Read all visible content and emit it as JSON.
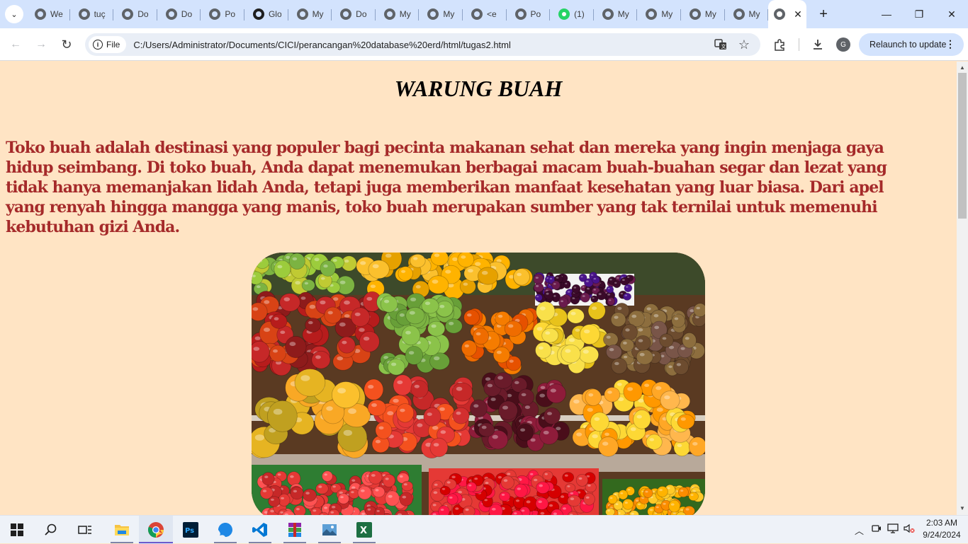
{
  "browser": {
    "tabs": [
      {
        "label": "We",
        "favicon": "globe-icon"
      },
      {
        "label": "tuç",
        "favicon": "globe-icon"
      },
      {
        "label": "Do",
        "favicon": "globe-icon"
      },
      {
        "label": "Do",
        "favicon": "globe-icon"
      },
      {
        "label": "Po",
        "favicon": "globe-icon"
      },
      {
        "label": "Glo",
        "favicon": "github-icon"
      },
      {
        "label": "My",
        "favicon": "globe-icon"
      },
      {
        "label": "Do",
        "favicon": "globe-icon"
      },
      {
        "label": "My",
        "favicon": "globe-icon"
      },
      {
        "label": "My",
        "favicon": "globe-icon"
      },
      {
        "label": "<e",
        "favicon": "globe-icon"
      },
      {
        "label": "Po",
        "favicon": "globe-icon"
      },
      {
        "label": "(1)",
        "favicon": "whatsapp-icon"
      },
      {
        "label": "My",
        "favicon": "globe-icon"
      },
      {
        "label": "My",
        "favicon": "globe-icon"
      },
      {
        "label": "My",
        "favicon": "globe-icon"
      },
      {
        "label": "My",
        "favicon": "globe-icon"
      }
    ],
    "active_tab_close": "✕",
    "new_tab": "+",
    "window": {
      "minimize": "—",
      "restore": "❐",
      "close": "✕"
    },
    "nav": {
      "back": "←",
      "forward": "→",
      "reload": "↻"
    },
    "address": {
      "chip_label": "File",
      "chip_icon": "i",
      "url": "C:/Users/Administrator/Documents/CICI/perancangan%20database%20erd/html/tugas2.html"
    },
    "avatar_letter": "G",
    "relaunch_label": "Relaunch to update",
    "menu_dots": "⋮"
  },
  "page": {
    "title": "WARUNG BUAH",
    "intro": "Toko buah adalah destinasi yang populer bagi pecinta makanan sehat dan mereka yang ingin menjaga gaya hidup seimbang. Di toko buah, Anda dapat menemukan berbagai macam buah-buahan segar dan lezat yang tidak hanya memanjakan lidah Anda, tetapi juga memberikan manfaat kesehatan yang luar biasa. Dari apel yang renyah hingga mangga yang manis, toko buah merupakan sumber yang tak ternilai untuk memenuhi kebutuhan gizi Anda.",
    "background_color": "#ffe4c4",
    "intro_color": "#a52a2a"
  },
  "taskbar": {
    "clock_time": "2:03 AM",
    "clock_date": "9/24/2024"
  }
}
